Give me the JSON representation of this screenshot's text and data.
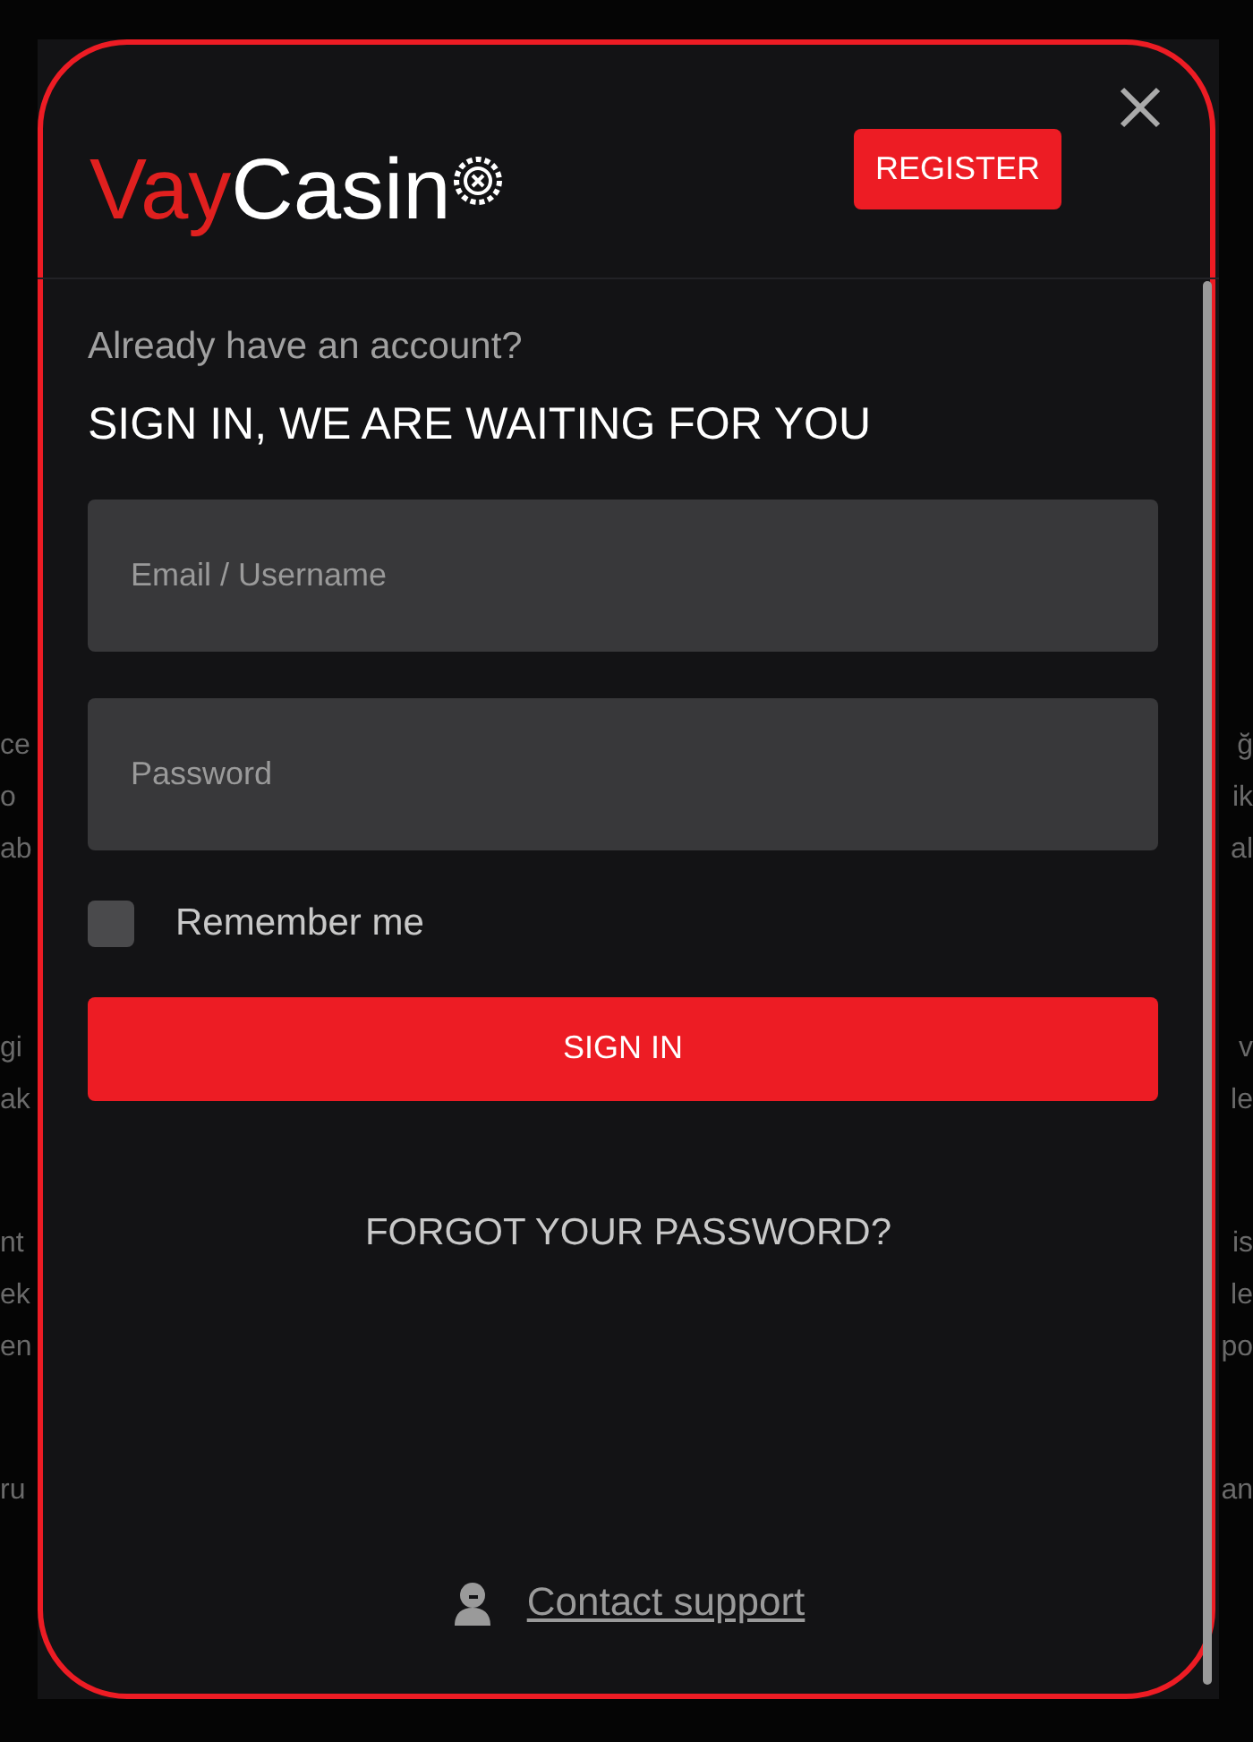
{
  "background_text": [
    {
      "lines": [
        {
          "left": "ce",
          "right": "ğ"
        },
        {
          "left": "o",
          "right": "ik"
        },
        {
          "left": "ab",
          "right": "al"
        }
      ]
    },
    {
      "lines": [
        {
          "left": "gi",
          "right": "v"
        },
        {
          "left": "ak",
          "right": "le"
        }
      ]
    },
    {
      "lines": [
        {
          "left": "nt",
          "right": "is"
        },
        {
          "left": "ek",
          "right": "le"
        },
        {
          "left": "en",
          "right": "po"
        }
      ]
    },
    {
      "lines": [
        {
          "left": "ru",
          "right": "an"
        }
      ]
    }
  ],
  "modal": {
    "logo": {
      "part_1": "Vay",
      "part_2": "Casin"
    },
    "register_button": "REGISTER",
    "subtitle": "Already have an account?",
    "heading": "SIGN IN, WE ARE WAITING FOR YOU",
    "fields": [
      {
        "placeholder": "Email / Username"
      },
      {
        "placeholder": "Password"
      }
    ],
    "remember": {
      "label": "Remember me",
      "checked": false
    },
    "sign_in_button": "SIGN IN",
    "forgot_link": "FORGOT YOUR PASSWORD?",
    "support_link": "Contact support"
  }
}
